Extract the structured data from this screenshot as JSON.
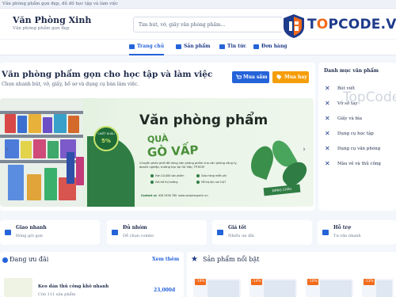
{
  "topbar": {
    "text": "Văn phòng phẩm gọn đẹp, đủ đồ học tập và làm việc"
  },
  "brand": {
    "name": "Văn Phòng Xinh",
    "tagline": "Văn phòng phẩm gọn đẹp"
  },
  "search": {
    "placeholder": "Tìm bút, vở, giấy văn phòng phẩm..."
  },
  "logo": {
    "text_top": "T",
    "text_o": "O",
    "text_rest": "PCODE.VN"
  },
  "nav": [
    {
      "label": "Trang chủ",
      "active": true
    },
    {
      "label": "Sản phẩm",
      "active": false
    },
    {
      "label": "Tin tức",
      "active": false
    },
    {
      "label": "Đơn hàng",
      "active": false
    }
  ],
  "hero": {
    "title": "Văn phòng phẩm gọn cho học tập và làm việc",
    "subtitle": "Chọn nhanh bút, vở, giấy, hồ sơ và dụng cụ bàn làm việc.",
    "buy_label": "Mua sắm",
    "promo_label": "Mua hay"
  },
  "banner": {
    "title": "Văn phòng phẩm",
    "quote_1": "QUÀ",
    "quote_2": "GÒ VẤP",
    "badge_top": "CHIẾT KHẤU",
    "badge_value": "5%",
    "description": "Chuyên phân phối đồ dùng văn phòng phẩm cho văn phòng công ty, doanh nghiệp, trường học tại Gò Vấp, TP.HCM",
    "features": [
      "Hơn 10.000 sản phẩm",
      "Giao hàng miễn phí",
      "Giá tốt thị trường",
      "Hỗ trợ tận nơi 24/7"
    ],
    "contact_label": "Contact us",
    "contact_phone": "028 3456 789",
    "contact_site": "www.vanphongxinh.vn",
    "tag": "ĐĂNG CHÂU"
  },
  "arrows": {
    "prev": "‹",
    "next": "›"
  },
  "sidebar": {
    "heading": "Danh mục văn phẩm",
    "items": [
      "Bút viết",
      "Vở sổ tay",
      "Giấy và bìa",
      "Dụng cụ học tập",
      "Dụng cụ văn phòng",
      "Màu vẽ và thủ công"
    ]
  },
  "watermark": "TopCode.vn",
  "features": [
    {
      "title": "Giao nhanh",
      "sub": "Đóng gói gọn"
    },
    {
      "title": "Đủ nhóm",
      "sub": "Dễ chọn combo"
    },
    {
      "title": "Giá tốt",
      "sub": "Nhiều ưu đãi"
    },
    {
      "title": "Hỗ trợ",
      "sub": "Tư vấn nhanh"
    }
  ],
  "deals": {
    "heading": "Đang ưu đãi",
    "view_all": "Xem thêm",
    "item": {
      "name": "Keo dán thủ công khô nhanh",
      "meta": "Còn 111 sản phẩm",
      "price": "23,000đ"
    }
  },
  "featured": {
    "heading": "Sản phẩm nổi bật",
    "badges": [
      "-19%",
      "-14%",
      "-10%",
      "-13%"
    ]
  },
  "colors": {
    "primary": "#2563d9",
    "accent": "#f59e0b",
    "brand_orange": "#f26a1b",
    "banner_green": "#2f7d44"
  }
}
